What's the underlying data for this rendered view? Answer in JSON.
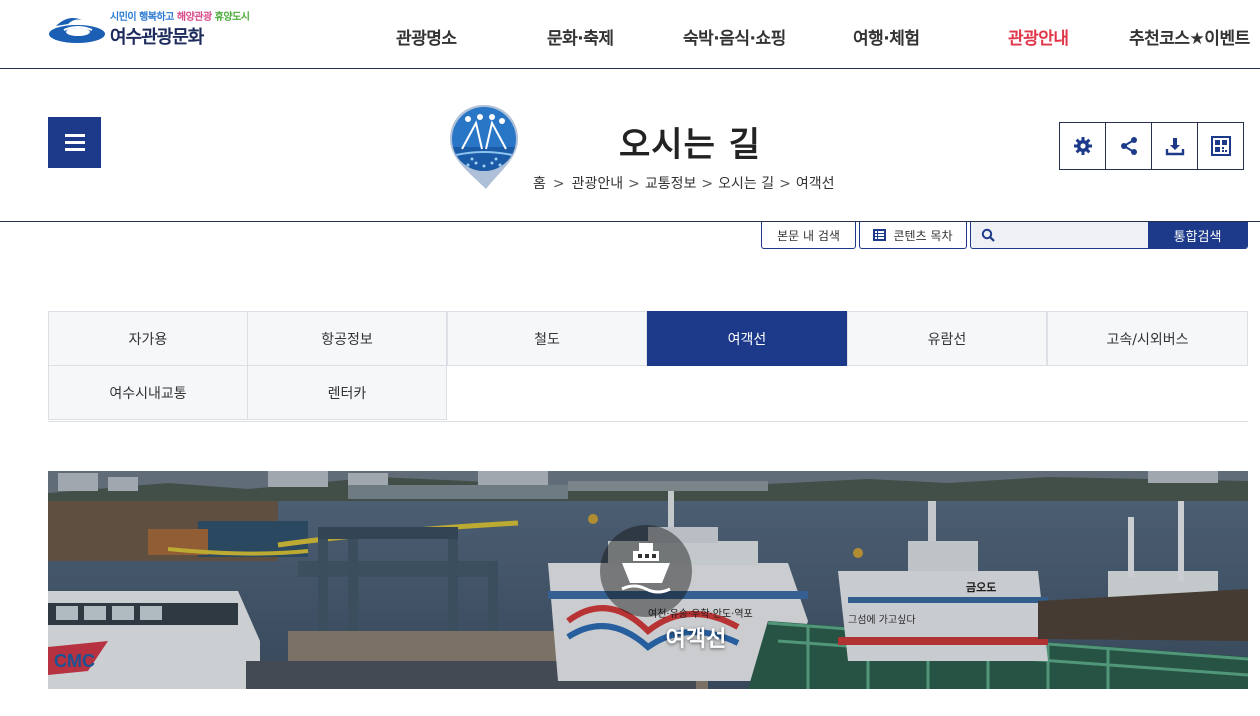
{
  "logo": {
    "slogan_a": "시민이 행복하고",
    "slogan_b": "해양관광",
    "slogan_c": "휴양도시",
    "name": "여수관광문화"
  },
  "gnb": {
    "items": [
      {
        "label": "관광명소",
        "active": false
      },
      {
        "label": "문화·축제",
        "active": false
      },
      {
        "label": "숙박·음식·쇼핑",
        "active": false
      },
      {
        "label": "여행·체험",
        "active": false
      },
      {
        "label": "관광안내",
        "active": true
      },
      {
        "label": "추천코스★이벤트",
        "active": false
      }
    ]
  },
  "page": {
    "title": "오시는 길",
    "breadcrumb": [
      "홈",
      "관광안내",
      "교통정보",
      "오시는 길",
      "여객선"
    ]
  },
  "tools": [
    "gear-icon",
    "share-icon",
    "download-icon",
    "qrcode-icon"
  ],
  "search": {
    "in_content": "본문 내 검색",
    "toc": "콘텐츠 목차",
    "placeholder": "",
    "submit": "통합검색"
  },
  "tabs": [
    {
      "label": "자가용",
      "active": false
    },
    {
      "label": "항공정보",
      "active": false
    },
    {
      "label": "철도",
      "active": false
    },
    {
      "label": "여객선",
      "active": true
    },
    {
      "label": "유람선",
      "active": false
    },
    {
      "label": "고속/시외버스",
      "active": false
    },
    {
      "label": "여수시내교통",
      "active": false
    },
    {
      "label": "렌터카",
      "active": false
    }
  ],
  "hero": {
    "title": "여객선",
    "icon": "ship-icon",
    "ferry_sign_1": "여천·유송·우학·안도·역포",
    "ferry_sign_2": "금오도",
    "ferry_sign_3": "그섬에 가고싶다",
    "hull_mark": "CMC"
  },
  "colors": {
    "primary": "#1d3a8a",
    "active_menu": "#e0384a",
    "border": "#25324f"
  }
}
